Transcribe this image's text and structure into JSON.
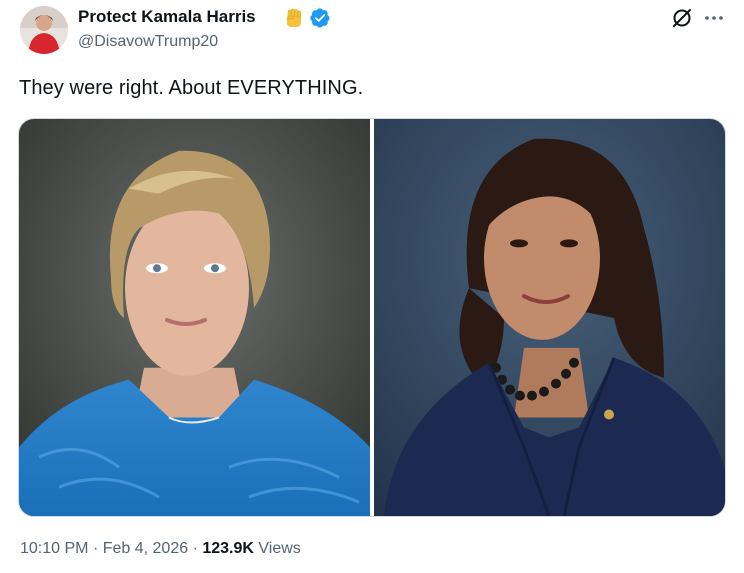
{
  "tweet": {
    "author_name": "Protect Kamala Harris",
    "author_emoji": "✊",
    "handle": "@DisavowTrump20",
    "text": "They were right. About EVERYTHING.",
    "time": "10:10 PM",
    "separator1": "·",
    "date": "Feb 4, 2026",
    "separator2": "·",
    "views_count": "123.9K",
    "views_label": "Views"
  },
  "icons": {
    "verified": "verified-badge-icon",
    "grok": "grok-icon",
    "more": "more-options-icon"
  },
  "colors": {
    "verified_blue": "#1d9bf0",
    "text_primary": "#0f1419",
    "text_secondary": "#536471"
  }
}
